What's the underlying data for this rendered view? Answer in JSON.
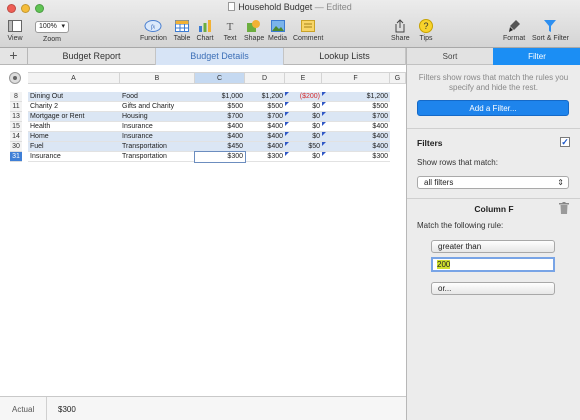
{
  "window": {
    "title": "Household Budget",
    "edited_label": "— Edited"
  },
  "toolbar": {
    "view": "View",
    "zoom_value": "100%",
    "zoom": "Zoom",
    "function": "Function",
    "table": "Table",
    "chart": "Chart",
    "text": "Text",
    "shape": "Shape",
    "media": "Media",
    "comment": "Comment",
    "share": "Share",
    "tips": "Tips",
    "format": "Format",
    "sort_filter": "Sort & Filter"
  },
  "sheet_tabs": {
    "add": "+",
    "items": [
      {
        "label": "Budget Report"
      },
      {
        "label": "Budget Details"
      },
      {
        "label": "Lookup Lists"
      }
    ],
    "active_index": 1
  },
  "table": {
    "columns": [
      "A",
      "B",
      "C",
      "D",
      "E",
      "F",
      "G"
    ],
    "selected_column": "C",
    "rows": [
      {
        "num": "8",
        "cells": [
          "Dining Out",
          "Food",
          "$1,000",
          "$1,200",
          "($200)",
          "$1,200"
        ],
        "highlight": true
      },
      {
        "num": "11",
        "cells": [
          "Charity 2",
          "Gifts and Charity",
          "$500",
          "$500",
          "$0",
          "$500"
        ],
        "highlight": false
      },
      {
        "num": "13",
        "cells": [
          "Mortgage or Rent",
          "Housing",
          "$700",
          "$700",
          "$0",
          "$700"
        ],
        "highlight": true
      },
      {
        "num": "15",
        "cells": [
          "Health",
          "Insurance",
          "$400",
          "$400",
          "$0",
          "$400"
        ],
        "highlight": false
      },
      {
        "num": "14",
        "cells": [
          "Home",
          "Insurance",
          "$400",
          "$400",
          "$0",
          "$400"
        ],
        "highlight": true
      },
      {
        "num": "30",
        "cells": [
          "Fuel",
          "Transportation",
          "$450",
          "$400",
          "$50",
          "$400"
        ],
        "highlight": true
      },
      {
        "num": "31",
        "cells": [
          "Insurance",
          "Transportation",
          "$300",
          "$300",
          "$0",
          "$300"
        ],
        "highlight": false
      }
    ]
  },
  "statusbar": {
    "label": "Actual",
    "value": "$300"
  },
  "inspector": {
    "tab_sort": "Sort",
    "tab_filter": "Filter",
    "description": "Filters show rows that match the rules you specify and hide the rest.",
    "add_filter": "Add a Filter...",
    "filters_heading": "Filters",
    "filters_checked": true,
    "show_rows_label": "Show rows that match:",
    "show_rows_value": "all filters",
    "column_heading": "Column F",
    "match_label": "Match the following rule:",
    "condition": "greater than",
    "rule_value": "200",
    "or_button": "or..."
  },
  "colors": {
    "accent": "#1b8ef4",
    "negative": "#d62b2b",
    "row_highlight": "#dbe6f4"
  }
}
